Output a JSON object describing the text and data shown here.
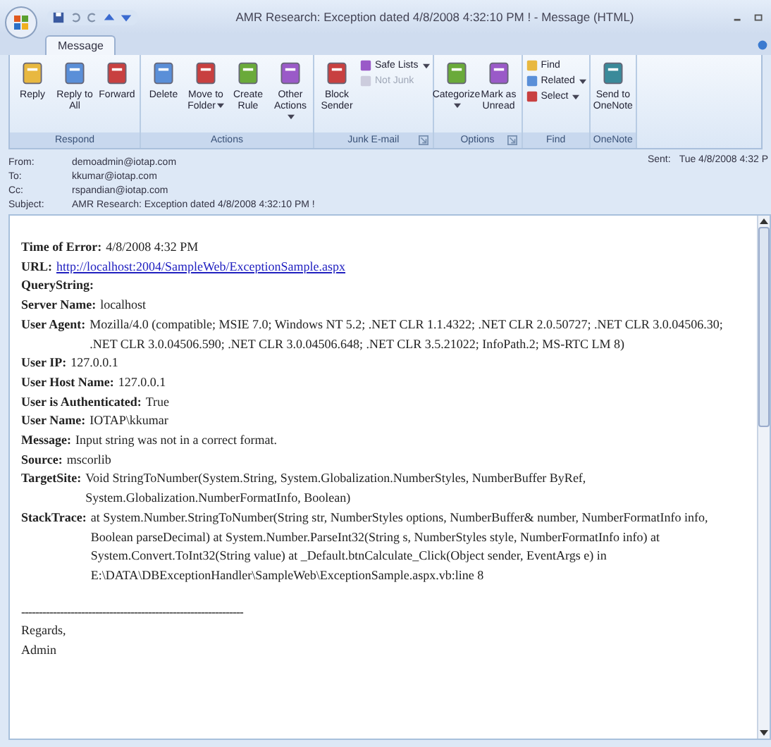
{
  "window": {
    "title": "AMR Research: Exception dated 4/8/2008 4:32:10 PM ! - Message (HTML)"
  },
  "tabs": [
    {
      "label": "Message",
      "selected": true
    }
  ],
  "ribbon": {
    "groups": [
      {
        "label": "Respond",
        "buttons": [
          {
            "label": "Reply",
            "dropdown": false,
            "disabled": false
          },
          {
            "label": "Reply to All",
            "dropdown": false,
            "disabled": false
          },
          {
            "label": "Forward",
            "dropdown": false,
            "disabled": false
          }
        ]
      },
      {
        "label": "Actions",
        "buttons": [
          {
            "label": "Delete",
            "dropdown": false,
            "disabled": false
          },
          {
            "label": "Move to Folder",
            "dropdown": true,
            "disabled": false
          },
          {
            "label": "Create Rule",
            "dropdown": false,
            "disabled": false
          },
          {
            "label": "Other Actions",
            "dropdown": true,
            "disabled": false
          }
        ]
      },
      {
        "label": "Junk E-mail",
        "launcher": true,
        "buttons": [
          {
            "label": "Block Sender",
            "dropdown": false,
            "disabled": false
          }
        ],
        "small_buttons": [
          {
            "label": "Safe Lists",
            "dropdown": true,
            "disabled": false
          },
          {
            "label": "Not Junk",
            "dropdown": false,
            "disabled": true
          }
        ]
      },
      {
        "label": "Options",
        "launcher": true,
        "buttons": [
          {
            "label": "Categorize",
            "dropdown": true,
            "disabled": false
          },
          {
            "label": "Mark as Unread",
            "dropdown": false,
            "disabled": false
          }
        ]
      },
      {
        "label": "Find",
        "small_buttons": [
          {
            "label": "Find",
            "dropdown": false,
            "disabled": false
          },
          {
            "label": "Related",
            "dropdown": true,
            "disabled": false
          },
          {
            "label": "Select",
            "dropdown": true,
            "disabled": false
          }
        ]
      },
      {
        "label": "OneNote",
        "buttons": [
          {
            "label": "Send to OneNote",
            "dropdown": false,
            "disabled": false
          }
        ]
      }
    ]
  },
  "header": {
    "fields": [
      {
        "label": "From:",
        "value": "demoadmin@iotap.com"
      },
      {
        "label": "To:",
        "value": "kkumar@iotap.com"
      },
      {
        "label": "Cc:",
        "value": "rspandian@iotap.com"
      },
      {
        "label": "Subject:",
        "value": "AMR Research: Exception dated 4/8/2008 4:32:10 PM !"
      }
    ],
    "sent": {
      "label": "Sent:",
      "value": "Tue 4/8/2008 4:32 P"
    }
  },
  "body": {
    "fields": [
      {
        "label": "Time of Error:",
        "value": "4/8/2008 4:32 PM",
        "kind": "text"
      },
      {
        "label": "URL:",
        "value": "http://localhost:2004/SampleWeb/ExceptionSample.aspx",
        "kind": "link"
      },
      {
        "label": "QueryString:",
        "kind": "text"
      },
      {
        "label": "Server Name:",
        "value": "localhost",
        "kind": "text"
      },
      {
        "label": "User Agent:",
        "value": "Mozilla/4.0 (compatible; MSIE 7.0; Windows NT 5.2; .NET CLR 1.1.4322; .NET CLR 2.0.50727; .NET CLR 3.0.04506.30; .NET CLR 3.0.04506.590; .NET CLR 3.0.04506.648; .NET CLR 3.5.21022; InfoPath.2; MS-RTC LM 8)",
        "kind": "text"
      },
      {
        "label": "User IP:",
        "value": "127.0.0.1",
        "kind": "text"
      },
      {
        "label": "User Host Name:",
        "value": "127.0.0.1",
        "kind": "text"
      },
      {
        "label": "User is Authenticated:",
        "value": "True",
        "kind": "text"
      },
      {
        "label": "User Name:",
        "value": "IOTAP\\kkumar",
        "kind": "text"
      },
      {
        "label": "Message:",
        "value": "Input string was not in a correct format.",
        "kind": "text"
      },
      {
        "label": "Source:",
        "value": "mscorlib",
        "kind": "text"
      },
      {
        "label": "TargetSite:",
        "value": "Void StringToNumber(System.String, System.Globalization.NumberStyles, NumberBuffer ByRef, System.Globalization.NumberFormatInfo, Boolean)",
        "kind": "text"
      },
      {
        "label": "StackTrace:",
        "value": "at System.Number.StringToNumber(String str, NumberStyles options, NumberBuffer& number, NumberFormatInfo info, Boolean parseDecimal) at System.Number.ParseInt32(String s, NumberStyles style, NumberFormatInfo info) at System.Convert.ToInt32(String value) at _Default.btnCalculate_Click(Object sender, EventArgs e) in E:\\DATA\\DBExceptionHandler\\SampleWeb\\ExceptionSample.aspx.vb:line 8",
        "kind": "text"
      }
    ],
    "separator": "---------------------------------------------------------------",
    "closing": [
      "Regards,",
      "Admin"
    ]
  }
}
